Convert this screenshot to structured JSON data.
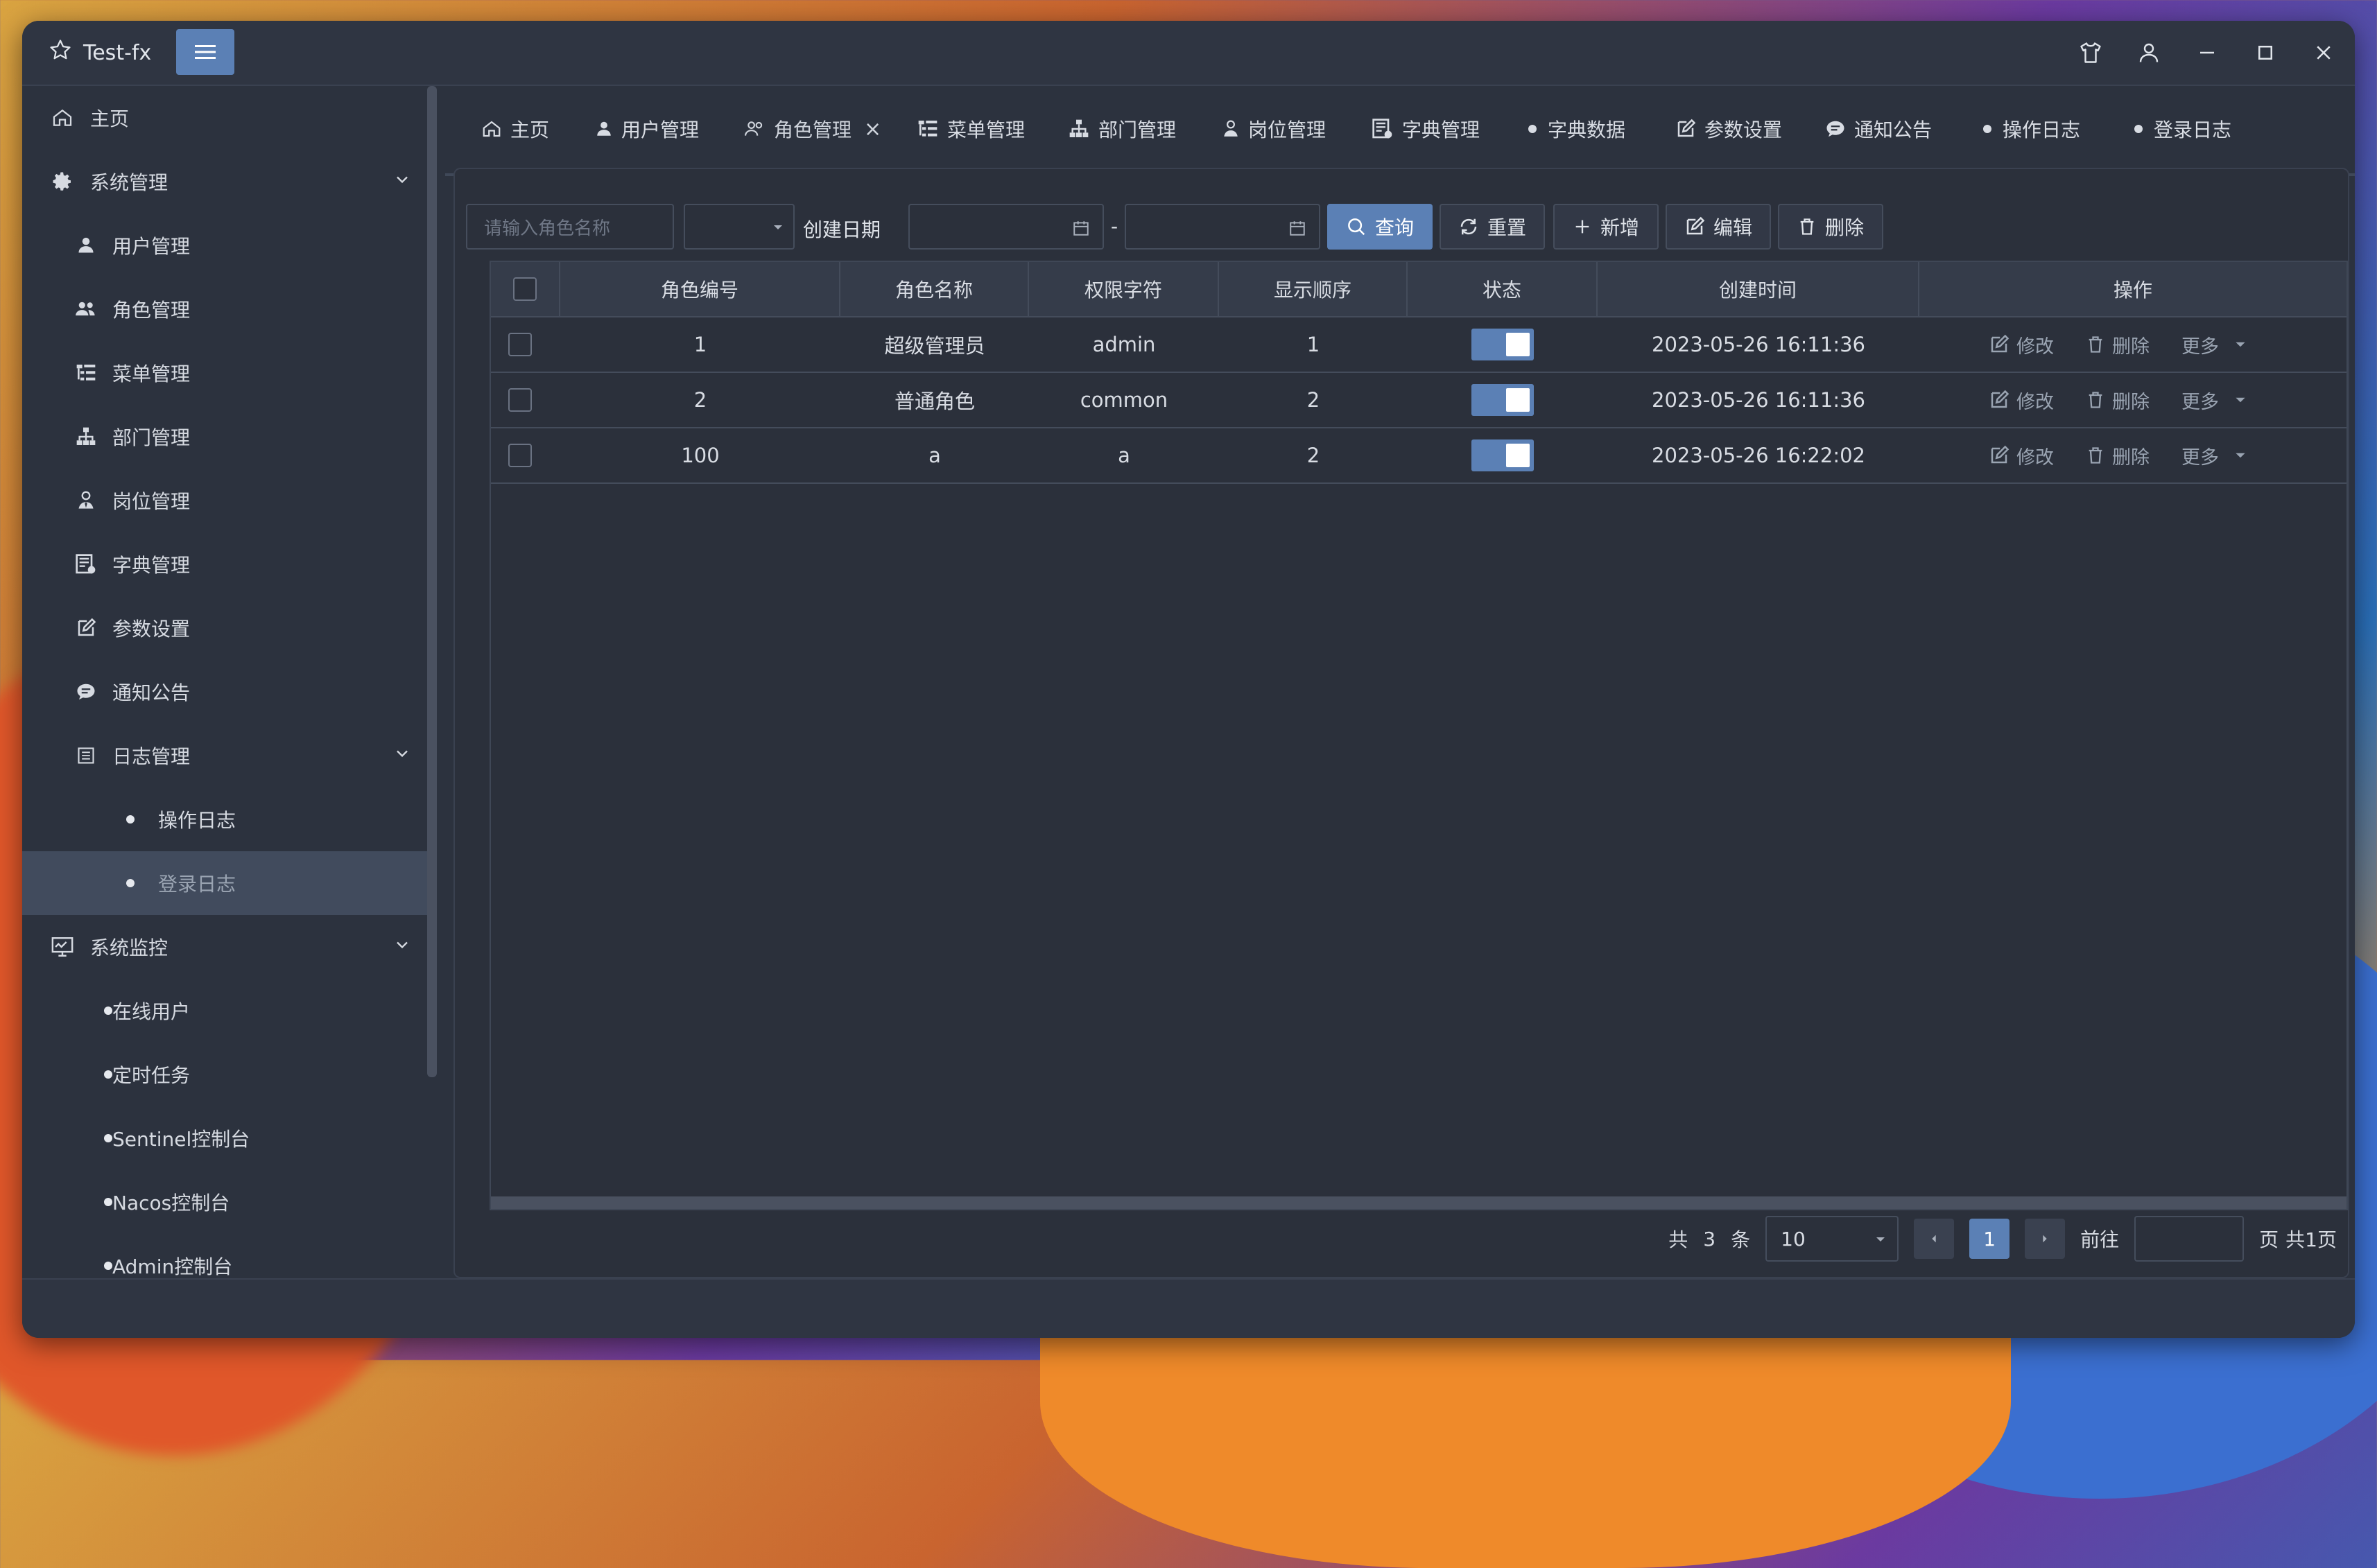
{
  "app": {
    "title": "Test-fx"
  },
  "sidebar": {
    "items": [
      {
        "label": "主页"
      },
      {
        "label": "系统管理"
      },
      {
        "label": "用户管理"
      },
      {
        "label": "角色管理"
      },
      {
        "label": "菜单管理"
      },
      {
        "label": "部门管理"
      },
      {
        "label": "岗位管理"
      },
      {
        "label": "字典管理"
      },
      {
        "label": "参数设置"
      },
      {
        "label": "通知公告"
      },
      {
        "label": "日志管理"
      },
      {
        "label": "操作日志"
      },
      {
        "label": "登录日志"
      },
      {
        "label": "系统监控"
      },
      {
        "label": "在线用户"
      },
      {
        "label": "定时任务"
      },
      {
        "label": "Sentinel控制台"
      },
      {
        "label": "Nacos控制台"
      },
      {
        "label": "Admin控制台"
      }
    ]
  },
  "tabs": [
    {
      "label": "主页"
    },
    {
      "label": "用户管理"
    },
    {
      "label": "角色管理",
      "close": "×"
    },
    {
      "label": "菜单管理"
    },
    {
      "label": "部门管理"
    },
    {
      "label": "岗位管理"
    },
    {
      "label": "字典管理"
    },
    {
      "label": "字典数据"
    },
    {
      "label": "参数设置"
    },
    {
      "label": "通知公告"
    },
    {
      "label": "操作日志"
    },
    {
      "label": "登录日志"
    }
  ],
  "toolbar": {
    "name_placeholder": "请输入角色名称",
    "date_label": "创建日期",
    "date_sep": "-",
    "search": "查询",
    "reset": "重置",
    "add": "新增",
    "edit": "编辑",
    "delete": "删除"
  },
  "table": {
    "headers": [
      "角色编号",
      "角色名称",
      "权限字符",
      "显示顺序",
      "状态",
      "创建时间",
      "操作"
    ],
    "rows": [
      {
        "id": "1",
        "name": "超级管理员",
        "key": "admin",
        "order": "1",
        "status": true,
        "created": "2023-05-26 16:11:36"
      },
      {
        "id": "2",
        "name": "普通角色",
        "key": "common",
        "order": "2",
        "status": true,
        "created": "2023-05-26 16:11:36"
      },
      {
        "id": "100",
        "name": "a",
        "key": "a",
        "order": "2",
        "status": true,
        "created": "2023-05-26 16:22:02"
      }
    ],
    "actions": {
      "edit": "修改",
      "delete": "删除",
      "more": "更多"
    }
  },
  "pager": {
    "total_prefix": "共",
    "total": "3",
    "total_suffix": "条",
    "page_size": "10",
    "current": "1",
    "goto": "前往",
    "page_suffix": "页",
    "pages": "共1页"
  },
  "colors": {
    "accent": "#5b80b5",
    "window": "#2c323e"
  }
}
